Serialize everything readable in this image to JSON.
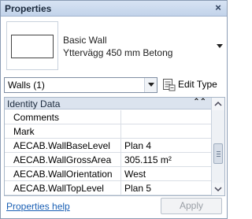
{
  "window": {
    "title": "Properties",
    "close_glyph": "×"
  },
  "type_selector": {
    "family": "Basic Wall",
    "type_name": "Yttervägg 450 mm Betong"
  },
  "filter": {
    "selected": "Walls (1)"
  },
  "edit_type": {
    "label": "Edit Type"
  },
  "properties_grid": {
    "group_header": "Identity Data",
    "collapse_glyph": "⌃⌃",
    "rows": [
      {
        "name": "Comments",
        "value": ""
      },
      {
        "name": "Mark",
        "value": ""
      },
      {
        "name": "AECAB.WallBaseLevel",
        "value": "Plan 4"
      },
      {
        "name": "AECAB.WallGrossArea",
        "value": "305.115 m²"
      },
      {
        "name": "AECAB.WallOrientation",
        "value": "West"
      },
      {
        "name": "AECAB.WallTopLevel",
        "value": "Plan 5"
      }
    ]
  },
  "footer": {
    "help_link": "Properties help",
    "apply_label": "Apply"
  },
  "colors": {
    "title_bar": "#c8d7ec",
    "link": "#1a5fb4",
    "disabled_text": "#9a9fa6"
  }
}
